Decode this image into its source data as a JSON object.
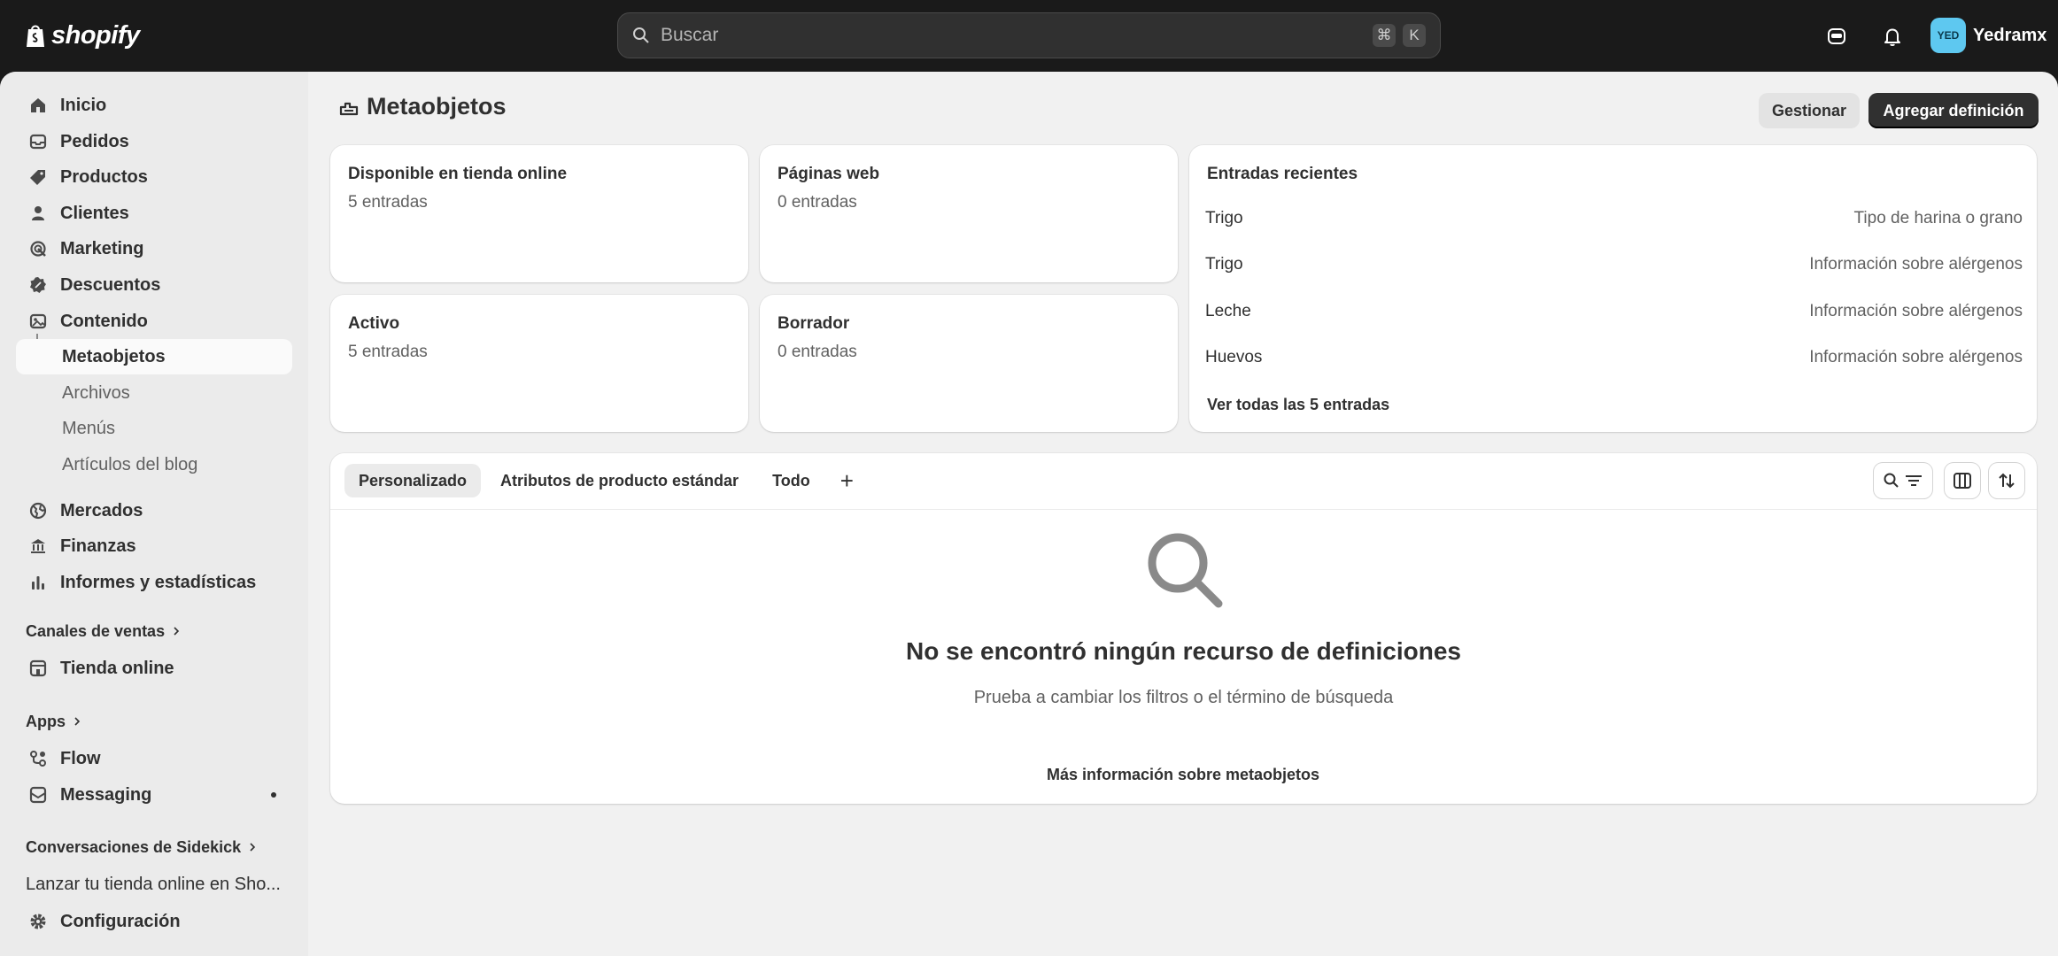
{
  "topbar": {
    "brand": "shopify",
    "search_placeholder": "Buscar",
    "shortcut_cmd": "⌘",
    "shortcut_key": "K",
    "avatar_initials": "YED",
    "user_name": "Yedramx"
  },
  "sidebar": {
    "items": [
      {
        "label": "Inicio"
      },
      {
        "label": "Pedidos"
      },
      {
        "label": "Productos"
      },
      {
        "label": "Clientes"
      },
      {
        "label": "Marketing"
      },
      {
        "label": "Descuentos"
      },
      {
        "label": "Contenido"
      }
    ],
    "content_sub": [
      "Metaobjetos",
      "Archivos",
      "Menús",
      "Artículos del blog"
    ],
    "items2": [
      {
        "label": "Mercados"
      },
      {
        "label": "Finanzas"
      },
      {
        "label": "Informes y estadísticas"
      }
    ],
    "sales_channels": {
      "label": "Canales de ventas",
      "items": [
        {
          "label": "Tienda online"
        }
      ]
    },
    "apps": {
      "label": "Apps",
      "items": [
        {
          "label": "Flow"
        },
        {
          "label": "Messaging"
        }
      ]
    },
    "sidekick": {
      "label": "Conversaciones de Sidekick",
      "item": "Lanzar tu tienda online en Sho..."
    },
    "settings": "Configuración"
  },
  "page": {
    "title": "Metaobjetos",
    "manage_button": "Gestionar",
    "add_button": "Agregar definición"
  },
  "cards": {
    "online_store": {
      "title": "Disponible en tienda online",
      "count": "5 entradas"
    },
    "web_pages": {
      "title": "Páginas web",
      "count": "0 entradas"
    },
    "active": {
      "title": "Activo",
      "count": "5 entradas"
    },
    "draft": {
      "title": "Borrador",
      "count": "0 entradas"
    }
  },
  "recent": {
    "title": "Entradas recientes",
    "rows": [
      {
        "name": "Trigo",
        "type": "Tipo de harina o grano"
      },
      {
        "name": "Trigo",
        "type": "Información sobre alérgenos"
      },
      {
        "name": "Leche",
        "type": "Información sobre alérgenos"
      },
      {
        "name": "Huevos",
        "type": "Información sobre alérgenos"
      }
    ],
    "see_all": "Ver todas las 5 entradas"
  },
  "definitions": {
    "tabs": [
      "Personalizado",
      "Atributos de producto estándar",
      "Todo"
    ],
    "add_tab": "+",
    "empty_title": "No se encontró ningún recurso de definiciones",
    "empty_sub": "Prueba a cambiar los filtros o el término de búsqueda"
  },
  "learn_more": "Más información sobre metaobjetos"
}
